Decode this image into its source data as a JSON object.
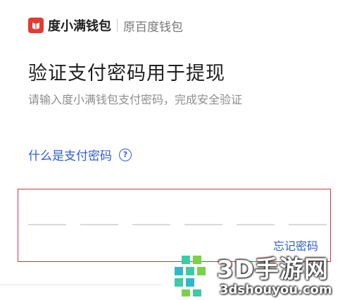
{
  "header": {
    "brand": "度小满钱包",
    "sub_brand": "原百度钱包"
  },
  "main": {
    "title": "验证支付密码用于提现",
    "subtitle": "请输入度小满钱包支付密码，完成安全验证",
    "help_link": "什么是支付密码",
    "help_icon_glyph": "?",
    "password_slot_count": 6,
    "forgot_link": "忘记密码"
  },
  "watermark": {
    "title": "3D手游网",
    "url": "3dshouyou.com"
  },
  "colors": {
    "brand_red": "#e23b32",
    "link_blue": "#2f5dd8",
    "highlight_red": "#d8323a"
  }
}
